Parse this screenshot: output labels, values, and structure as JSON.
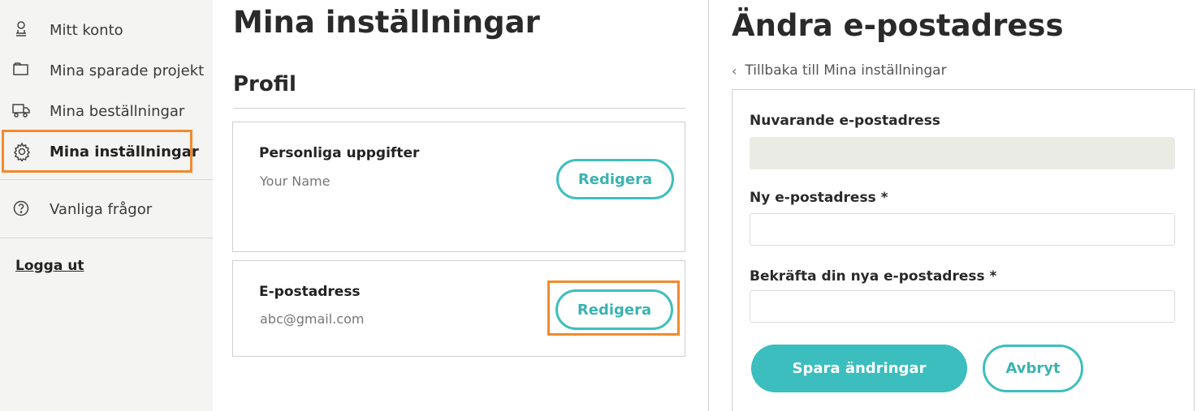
{
  "sidebar": {
    "items": [
      {
        "label": "Mitt konto",
        "icon": "account-icon"
      },
      {
        "label": "Mina sparade projekt",
        "icon": "folder-icon"
      },
      {
        "label": "Mina beställningar",
        "icon": "truck-icon"
      },
      {
        "label": "Mina inställningar",
        "icon": "gear-icon",
        "active": true
      },
      {
        "label": "Vanliga frågor",
        "icon": "question-icon"
      }
    ],
    "logout_label": "Logga ut"
  },
  "main": {
    "title": "Mina inställningar",
    "section_title": "Profil",
    "cards": [
      {
        "title": "Personliga uppgifter",
        "value": "Your Name",
        "button_label": "Redigera"
      },
      {
        "title": "E-postadress",
        "value": "abc@gmail.com",
        "button_label": "Redigera"
      }
    ]
  },
  "email_form": {
    "title": "Ändra e-postadress",
    "back_link": "Tillbaka till Mina inställningar",
    "current_label": "Nuvarande e-postadress",
    "current_value": "",
    "new_label": "Ny e-postadress *",
    "new_value": "",
    "confirm_label": "Bekräfta din nya e-postadress *",
    "confirm_value": "",
    "save_label": "Spara ändringar",
    "cancel_label": "Avbryt"
  },
  "colors": {
    "accent": "#3bbebd",
    "highlight": "#f28a2e",
    "sidebar_bg": "#f4f4f3",
    "readonly_bg": "#ebebe5"
  }
}
